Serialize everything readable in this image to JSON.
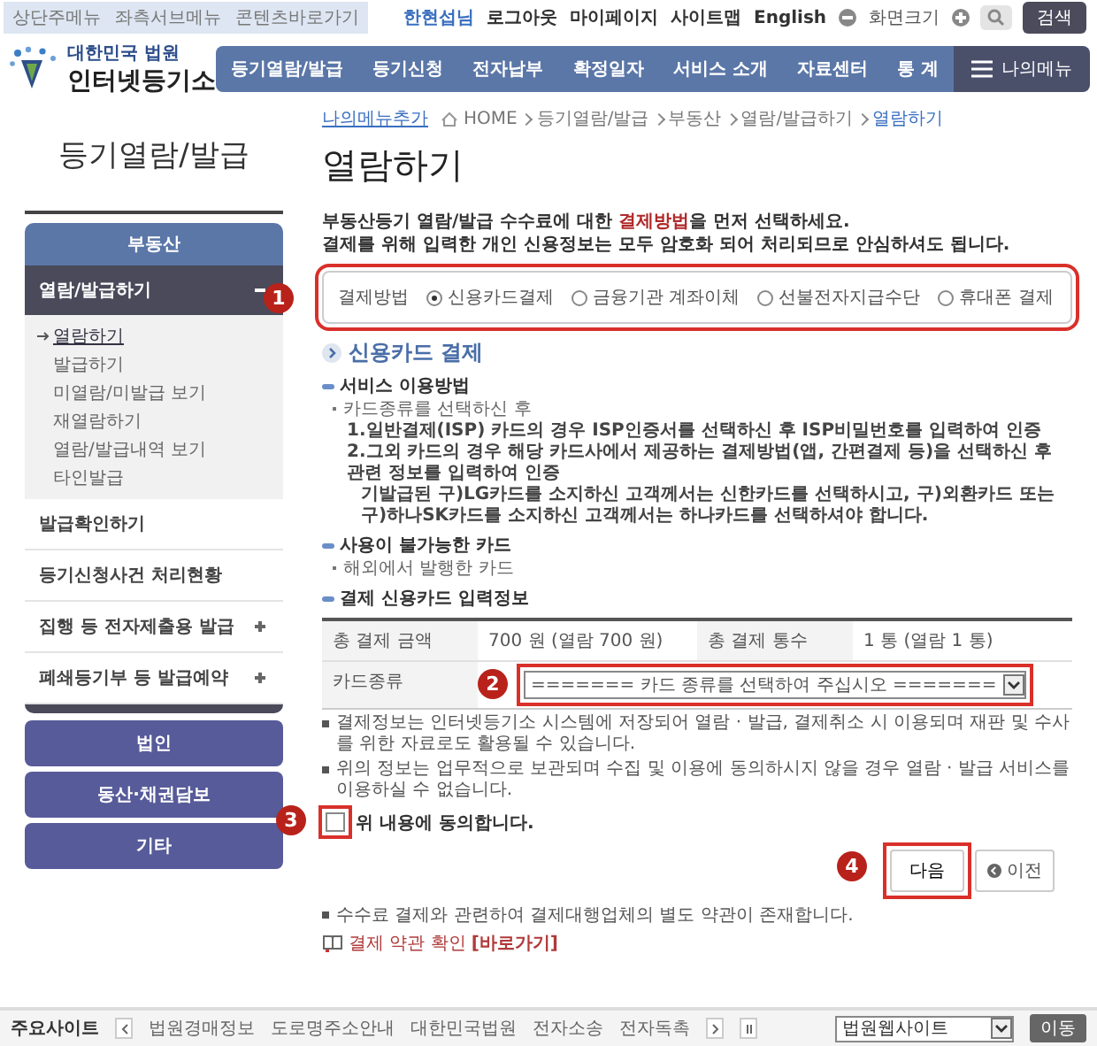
{
  "skip_links": [
    "상단주메뉴",
    "좌측서브메뉴",
    "콘텐츠바로가기"
  ],
  "top_links": [
    {
      "label": "한현섭님",
      "kind": "user"
    },
    {
      "label": "로그아웃",
      "kind": "link"
    },
    {
      "label": "마이페이지",
      "kind": "link"
    },
    {
      "label": "사이트맵",
      "kind": "link"
    },
    {
      "label": "English",
      "kind": "link"
    }
  ],
  "font_size": {
    "label": "화면크기"
  },
  "search": {
    "button": "검색"
  },
  "logo": {
    "subtitle": "대한민국 법원",
    "title": "인터넷등기소"
  },
  "nav": {
    "items": [
      "등기열람/발급",
      "등기신청",
      "전자납부",
      "확정일자",
      "서비스 소개",
      "자료센터",
      "통 계"
    ],
    "my_menu": "나의메뉴"
  },
  "breadcrumb": {
    "add_button": "나의메뉴추가",
    "items": [
      {
        "label": "HOME",
        "selected": false
      },
      {
        "label": "등기열람/발급",
        "selected": false
      },
      {
        "label": "부동산",
        "selected": false
      },
      {
        "label": "열람/발급하기",
        "selected": false
      },
      {
        "label": "열람하기",
        "selected": true
      }
    ]
  },
  "sidebar": {
    "title": "등기열람/발급",
    "category": "부동산",
    "groups": [
      {
        "label": "열람/발급하기",
        "expanded": true,
        "children": [
          {
            "label": "열람하기",
            "selected": true
          },
          {
            "label": "발급하기",
            "selected": false
          },
          {
            "label": "미열람/미발급 보기",
            "selected": false
          },
          {
            "label": "재열람하기",
            "selected": false
          },
          {
            "label": "열람/발급내역 보기",
            "selected": false
          },
          {
            "label": "타인발급",
            "selected": false
          }
        ]
      },
      {
        "label": "발급확인하기"
      },
      {
        "label": "등기신청사건 처리현황"
      },
      {
        "label": "집행 등 전자제출용 발급",
        "expanded": false
      },
      {
        "label": "폐쇄등기부 등 발급예약",
        "expanded": false
      }
    ],
    "other_categories": [
      "법인",
      "동산·채권담보",
      "기타"
    ]
  },
  "page_title": "열람하기",
  "intro": [
    "부동산등기 열람/발급 수수료에 대한 **결제방법**을 먼저 선택하세요.",
    "결제를 위해 입력한 개인 신용정보는 모두 암호화 되어 처리되므로 안심하셔도 됩니다."
  ],
  "payment_method": {
    "label": "결제방법",
    "options": [
      {
        "label": "신용카드결제",
        "selected": true
      },
      {
        "label": "금융기관 계좌이체",
        "selected": false
      },
      {
        "label": "선불전자지급수단",
        "selected": false
      },
      {
        "label": "휴대폰 결제",
        "selected": false
      }
    ]
  },
  "section_title": "신용카드 결제",
  "guide": {
    "heading": "서비스 이용방법",
    "lead": "카드종류를 선택하신 후",
    "steps": [
      "1.일반결제(ISP) 카드의 경우 ISP인증서를 선택하신 후 ISP비밀번호를 입력하여 인증",
      "2.그외 카드의 경우 해당 카드사에서 제공하는 결제방법(앱, 간편결제 등)을 선택하신 후 관련 정보를 입력하여 인증",
      "기발급된 구)LG카드를 소지하신 고객께서는 신한카드를 선택하시고, 구)외환카드 또는 구)하나SK카드를 소지하신 고객께서는 하나카드를 선택하셔야 합니다."
    ]
  },
  "unavailable": {
    "heading": "사용이 불가능한 카드",
    "items": [
      "해외에서 발행한 카드"
    ]
  },
  "card_info": {
    "heading": "결제 신용카드 입력정보",
    "total_amount_label": "총 결제 금액",
    "total_amount": "700 원 (열람 700 원)",
    "total_count_label": "총 결제 통수",
    "total_count": "1 통 (열람 1 통)",
    "card_type_label": "카드종류",
    "card_type_placeholder": "======= 카드 종류를 선택하여 주십시오 ======="
  },
  "notices": [
    "결제정보는 인터넷등기소 시스템에 저장되어 열람 · 발급, 결제취소 시 이용되며 재판 및 수사를 위한 자료로도 활용될 수 있습니다.",
    "위의 정보는 업무적으로 보관되며 수집 및 이용에 동의하시지 않을 경우 열람 · 발급 서비스를 이용하실 수 없습니다."
  ],
  "agree": {
    "label": "위 내용에 동의합니다.",
    "checked": false
  },
  "buttons": {
    "next": "다음",
    "prev": "이전"
  },
  "terms": {
    "note": "수수료 결제와 관련하여 결제대행업체의 별도 약관이 존재합니다.",
    "label": "결제 약관 확인",
    "link": "[바로가기]"
  },
  "annotations": [
    "1",
    "2",
    "3",
    "4"
  ],
  "footer": {
    "label": "주요사이트",
    "links": [
      "법원경매정보",
      "도로명주소안내",
      "대한민국법원",
      "전자소송",
      "전자독촉"
    ],
    "select": "법원웹사이트",
    "go": "이동"
  }
}
